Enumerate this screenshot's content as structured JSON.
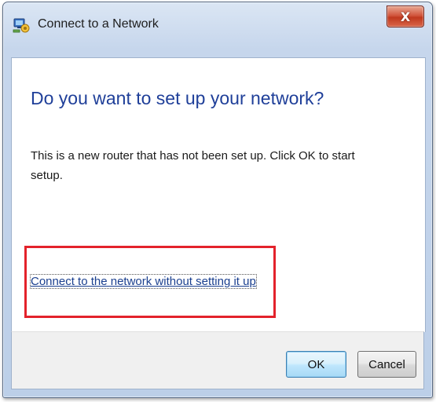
{
  "window": {
    "title": "Connect to a Network",
    "close_glyph": "X"
  },
  "main": {
    "heading": "Do you want to set up your network?",
    "description": "This is a new router that has not been set up. Click OK to start setup.",
    "link_text": "Connect to the network without setting it up"
  },
  "buttons": {
    "ok_label": "OK",
    "cancel_label": "Cancel"
  },
  "colors": {
    "heading": "#1f3f99",
    "link": "#1a3f8f",
    "highlight_border": "#e3222b",
    "close_button": "#c0391e"
  },
  "icons": {
    "app_icon": "network-setup-icon",
    "close_icon": "close-icon"
  }
}
